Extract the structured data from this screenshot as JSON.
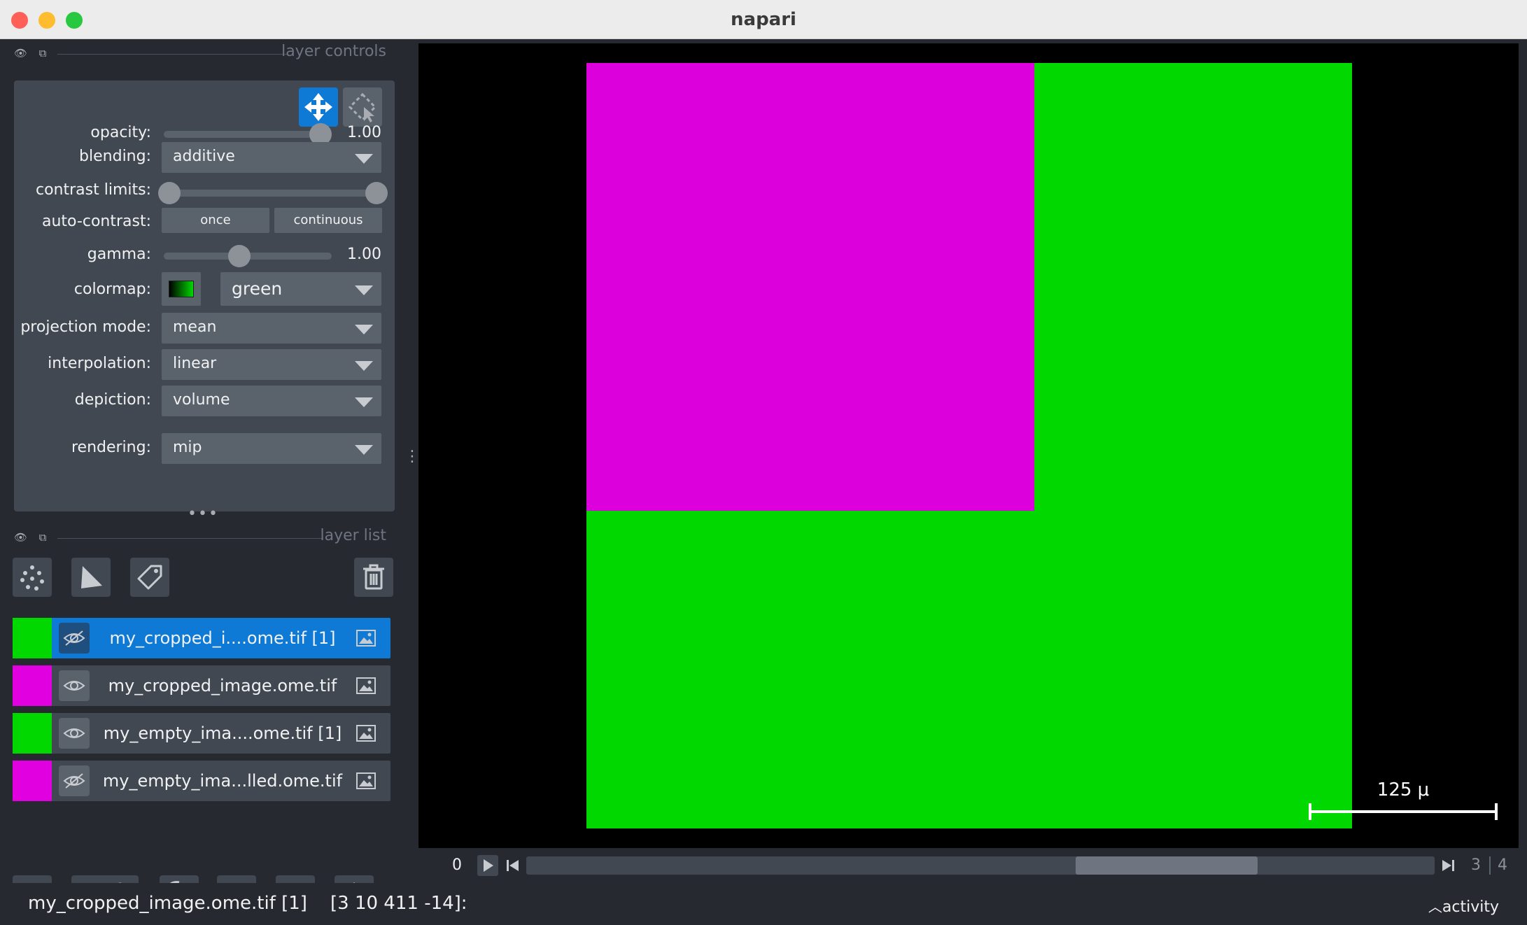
{
  "window": {
    "title": "napari",
    "close_color": "#ff5f57",
    "minimize_color": "#febc2e",
    "zoom_color": "#28c840"
  },
  "layer_controls": {
    "title": "layer controls",
    "opacity": {
      "label": "opacity:",
      "value": "1.00",
      "fraction": 1.0
    },
    "blending": {
      "label": "blending:",
      "value": "additive"
    },
    "contrast_limits": {
      "label": "contrast limits:",
      "low_fraction": 0.0,
      "high_fraction": 1.0
    },
    "auto_contrast": {
      "label": "auto-contrast:",
      "once": "once",
      "continuous": "continuous"
    },
    "gamma": {
      "label": "gamma:",
      "value": "1.00",
      "fraction": 0.45
    },
    "colormap": {
      "label": "colormap:",
      "value": "green"
    },
    "projection_mode": {
      "label": "projection mode:",
      "value": "mean"
    },
    "interpolation": {
      "label": "interpolation:",
      "value": "linear"
    },
    "depiction": {
      "label": "depiction:",
      "value": "volume"
    },
    "rendering": {
      "label": "rendering:",
      "value": "mip"
    }
  },
  "layer_list": {
    "title": "layer list",
    "layers": [
      {
        "name": "my_cropped_i....ome.tif [1]",
        "color": "#00d800",
        "visible": false,
        "selected": true
      },
      {
        "name": "my_cropped_image.ome.tif",
        "color": "#e000e0",
        "visible": true,
        "selected": false
      },
      {
        "name": "my_empty_ima....ome.tif [1]",
        "color": "#00d800",
        "visible": true,
        "selected": false
      },
      {
        "name": "my_empty_ima...lled.ome.tif",
        "color": "#e000e0",
        "visible": false,
        "selected": false
      }
    ]
  },
  "canvas": {
    "scale_bar_label": "125 μ",
    "magenta": "#dc00dc",
    "green": "#00d800"
  },
  "dims": {
    "current": "0",
    "axis_a": "3",
    "axis_b": "4",
    "thumb_start_fraction": 0.605,
    "thumb_end_fraction": 0.805
  },
  "status": {
    "text": "my_cropped_image.ome.tif [1]    [3 10 411 -14]:",
    "activity": "activity"
  },
  "theme": {
    "accent": "#0f7ad6"
  }
}
